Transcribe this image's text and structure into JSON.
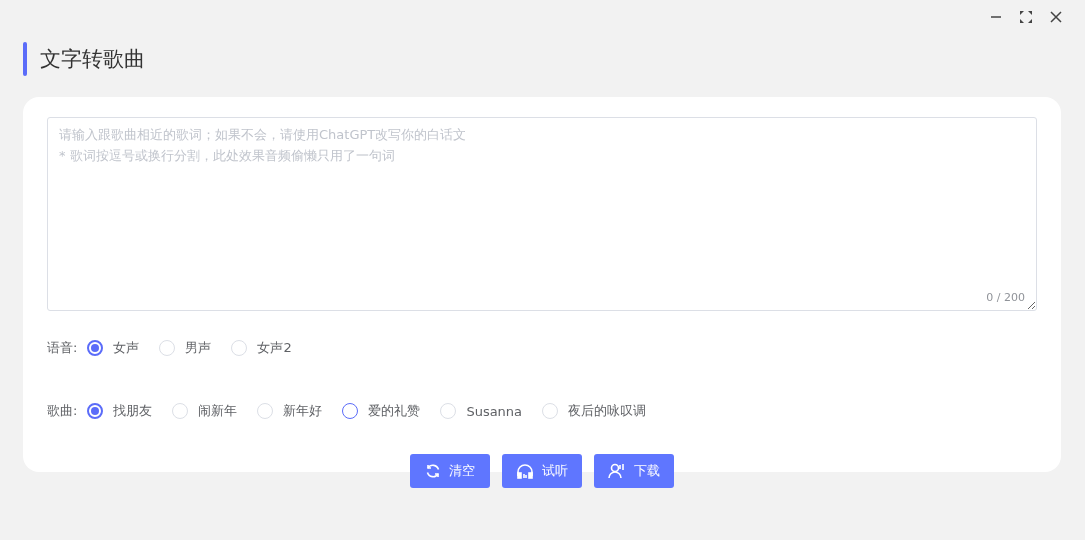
{
  "page_title": "文字转歌曲",
  "lyrics": {
    "placeholder": "请输入跟歌曲相近的歌词；如果不会，请使用ChatGPT改写你的白话文\n* 歌词按逗号或换行分割，此处效果音频偷懒只用了一句词",
    "counter": "0 / 200"
  },
  "voice": {
    "label": "语音:",
    "options": [
      {
        "label": "女声",
        "selected": true
      },
      {
        "label": "男声",
        "selected": false
      },
      {
        "label": "女声2",
        "selected": false
      }
    ]
  },
  "song": {
    "label": "歌曲:",
    "options": [
      {
        "label": "找朋友",
        "selected": true,
        "hovered": false
      },
      {
        "label": "闹新年",
        "selected": false,
        "hovered": false
      },
      {
        "label": "新年好",
        "selected": false,
        "hovered": false
      },
      {
        "label": "爱的礼赞",
        "selected": false,
        "hovered": true
      },
      {
        "label": "Susanna",
        "selected": false,
        "hovered": false
      },
      {
        "label": "夜后的咏叹调",
        "selected": false,
        "hovered": false
      }
    ]
  },
  "buttons": [
    {
      "kind": "clear",
      "label": "清空"
    },
    {
      "kind": "listen",
      "label": "试听"
    },
    {
      "kind": "download",
      "label": "下载"
    }
  ]
}
